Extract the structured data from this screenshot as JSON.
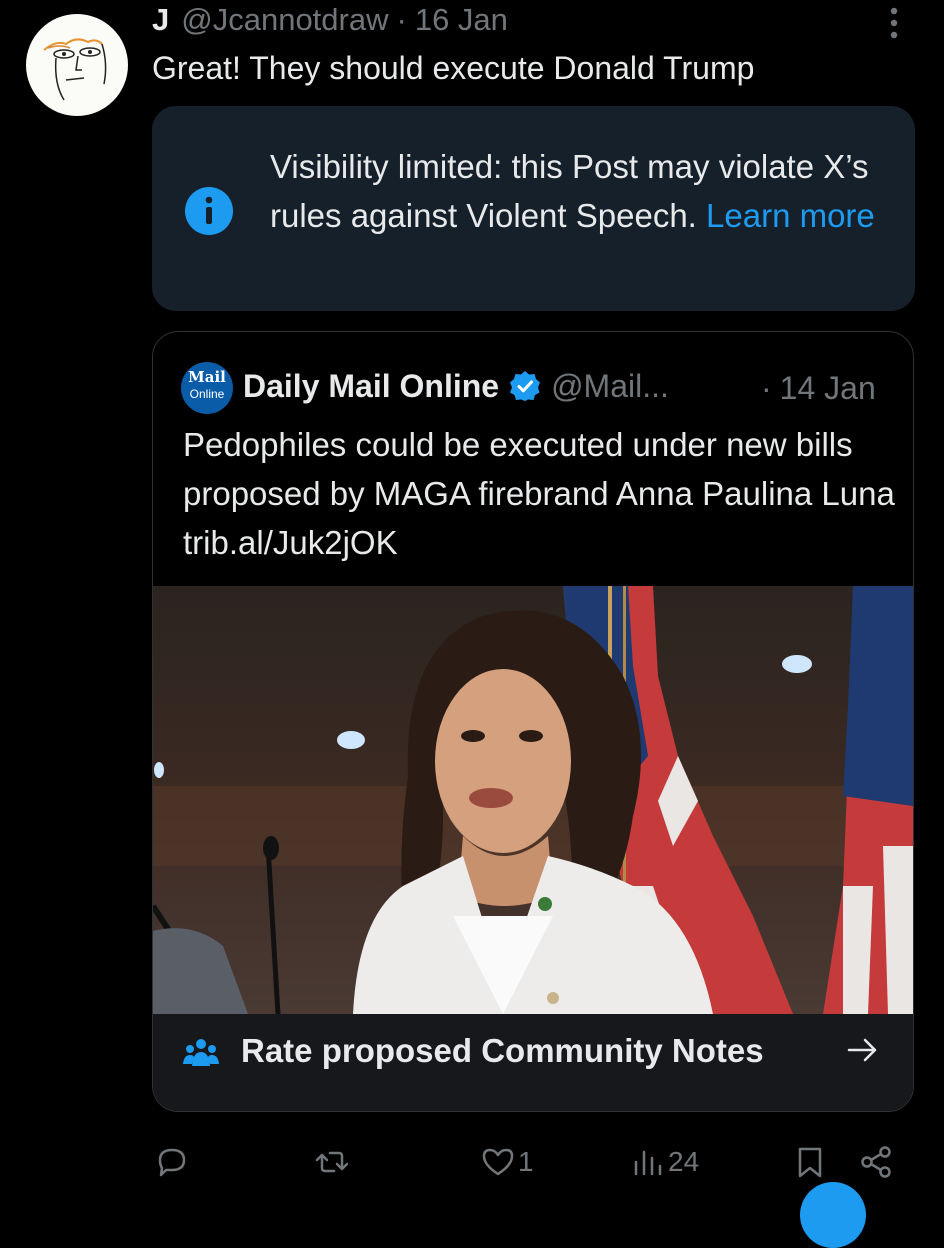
{
  "post": {
    "name": "J",
    "handle": "@Jcannotdraw",
    "separator": "·",
    "time": "16 Jan",
    "text": "Great! They should execute Donald Trump"
  },
  "notice": {
    "text": "Visibility limited: this Post may violate X’s rules against Violent Speech.",
    "link": "Learn more",
    "icon": "info-icon"
  },
  "quote": {
    "logo_line1": "Mail",
    "logo_line2": "Online",
    "name": "Daily Mail Online",
    "handle": "@Mail...",
    "separator": "·",
    "time": "14 Jan",
    "text": "Pedophiles could be executed under new bills proposed by MAGA firebrand Anna Paulina Luna trib.al/Juk2jOK",
    "community_notes_label": "Rate proposed Community Notes"
  },
  "actions": {
    "reply_count": "",
    "repost_count": "",
    "like_count": "1",
    "views_count": "24"
  },
  "colors": {
    "background": "#000000",
    "notice_bg": "#16202a",
    "accent": "#1d9bf0",
    "muted": "#71767b",
    "text": "#e7e9ea"
  }
}
